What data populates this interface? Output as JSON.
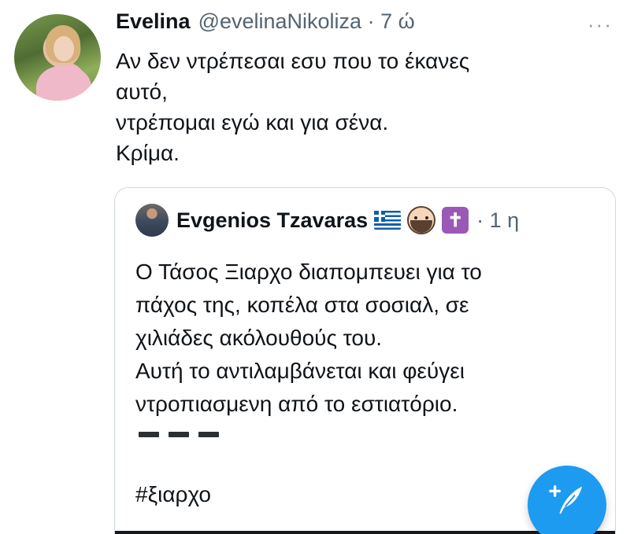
{
  "tweet": {
    "author_name": "Evelina",
    "author_handle": "@evelinaNikoliza",
    "separator": "·",
    "time": "7 ώ",
    "more_icon": "more-horizontal-icon",
    "lines": [
      "Αν δεν ντρέπεσαι εσυ που το έκανες",
      "αυτό,",
      "ντρέπομαι εγώ και για σένα.",
      "Κρίμα."
    ]
  },
  "quoted": {
    "author_name": "Evgenios Tzavaras",
    "badges": [
      "greek-flag-icon",
      "bearded-face-icon",
      "latin-cross-icon"
    ],
    "separator": "·",
    "time": "1 η",
    "lines": [
      "Ο Τάσος Ξιαρχο διαπομπευει για το",
      "πάχος της, κοπέλα στα σοσιαλ, σε",
      "χιλιάδες ακόλουθούς του.",
      "Αυτή το αντιλαμβάνεται και φεύγει",
      "ντροπιασμενη από το εστιατόριο."
    ],
    "hashtag": "#ξιαρχο"
  },
  "compose": {
    "icon": "compose-tweet-icon",
    "accent": "#1d9bf0"
  }
}
